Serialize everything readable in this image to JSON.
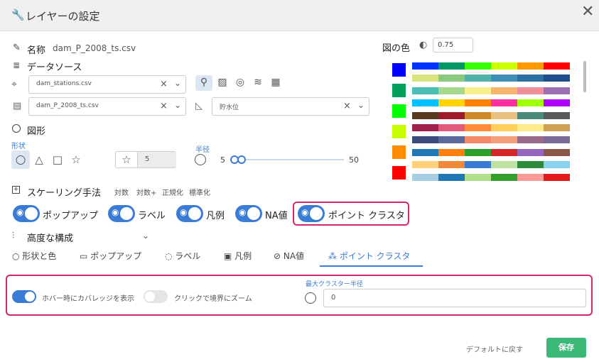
{
  "dialog": {
    "title": "レイヤーの設定",
    "close_icon": "close-icon"
  },
  "name": {
    "label": "名称",
    "value": "dam_P_2008_ts.csv"
  },
  "datasource": {
    "label": "データソース",
    "dataset1": "dam_stations.csv",
    "dataset2": "dam_P_2008_ts.csv",
    "field": "貯水位"
  },
  "shape": {
    "label": "図形",
    "shape_label": "形状",
    "size_value": "5",
    "radius_label": "半径",
    "radius_min": "5",
    "radius_max": "50"
  },
  "scaling": {
    "label": "スケーリング手法",
    "options": [
      "対数",
      "対数+",
      "正規化",
      "標準化"
    ]
  },
  "toggles": [
    "ポップアップ",
    "ラベル",
    "凡例",
    "NA値",
    "ポイント クラスタ"
  ],
  "advanced": {
    "label": "高度な構成"
  },
  "tabs": [
    "形状と色",
    "ポップアップ",
    "ラベル",
    "凡例",
    "NA値",
    "ポイント クラスタ"
  ],
  "cluster": {
    "hover_label": "ホバー時にカバレッジを表示",
    "zoom_label": "クリックで境界にズーム",
    "max_radius_label": "最大クラスター半径",
    "max_radius_value": "0"
  },
  "color": {
    "label": "図の色",
    "opacity": "0.75"
  },
  "footer": {
    "reset": "デフォルトに戻す",
    "save": "保存"
  },
  "colors": {
    "main": [
      "#0000ff",
      "#00a05a",
      "#00ff00",
      "#c8ff00",
      "#ff8c00",
      "#ff0000"
    ],
    "palettes": [
      [
        "#0033ff",
        "#009966",
        "#33ff00",
        "#ccff00",
        "#ff9900",
        "#ff0000"
      ],
      [
        "#d7e37d",
        "#8bc97f",
        "#4fb3a6",
        "#3d8fb5",
        "#2b6fa3",
        "#1f4e8c"
      ],
      [
        "#4cbfb5",
        "#a7d98c",
        "#f7ef8a",
        "#f5b56e",
        "#ee8f9c",
        "#9a6fb3"
      ],
      [
        "#00c0ff",
        "#ffd400",
        "#ff7f00",
        "#ff2fa0",
        "#a0ff00",
        "#b000ff"
      ],
      [
        "#5a3a1f",
        "#a01a2a",
        "#d08a2a",
        "#e8c080",
        "#4a8a7a",
        "#5a5a5a"
      ],
      [
        "#a0224a",
        "#e05a7a",
        "#ff8a3a",
        "#ffcf5a",
        "#ffea8a",
        "#d0a050"
      ],
      [
        "#3a4a7a",
        "#5a6a9a",
        "#f58a6a",
        "#f5a07a",
        "#9a6a8a",
        "#7a6a9a"
      ],
      [
        "#1f77b4",
        "#ff7f0e",
        "#2ca02c",
        "#d62728",
        "#9467bd",
        "#8c564b"
      ],
      [
        "#ffd07a",
        "#f08a3a",
        "#3a7ad0",
        "#c0e0a0",
        "#2a8a3a",
        "#8ad0f0"
      ],
      [
        "#a6cee3",
        "#1f78b4",
        "#b2df8a",
        "#33a02c",
        "#fb9a99",
        "#e31a1c"
      ]
    ]
  }
}
